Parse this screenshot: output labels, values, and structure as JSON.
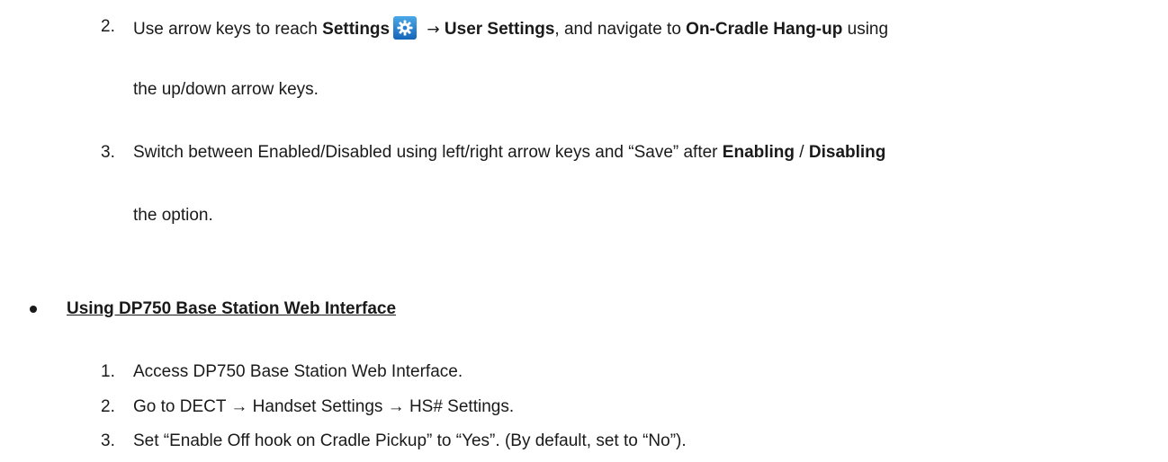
{
  "steps_top": [
    {
      "num": "2.",
      "parts": {
        "a": "Use arrow keys to reach ",
        "b_settings": "Settings",
        "arrow": "→",
        "b_user_settings": "User Settings",
        "c": ", and navigate to ",
        "b_on_cradle": "On-Cradle Hang-up",
        "d": " using"
      },
      "continuation": "the up/down arrow keys."
    },
    {
      "num": "3.",
      "parts": {
        "a": "Switch between Enabled/Disabled using left/right arrow keys and “Save” after ",
        "b_enabling": "Enabling",
        "sep": " / ",
        "b_disabling": "Disabling"
      },
      "continuation": "the option."
    }
  ],
  "section": {
    "title": "Using DP750 Base Station Web Interface",
    "steps": [
      {
        "num": "1.",
        "text": "Access DP750 Base Station Web Interface."
      },
      {
        "num": "2.",
        "text": "Go to DECT → Handset Settings → HS# Settings."
      },
      {
        "num": "3.",
        "text": "Set “Enable Off hook on Cradle Pickup” to “Yes”. (By default, set to “No”)."
      }
    ]
  },
  "icons": {
    "settings": "settings-gear-icon"
  }
}
